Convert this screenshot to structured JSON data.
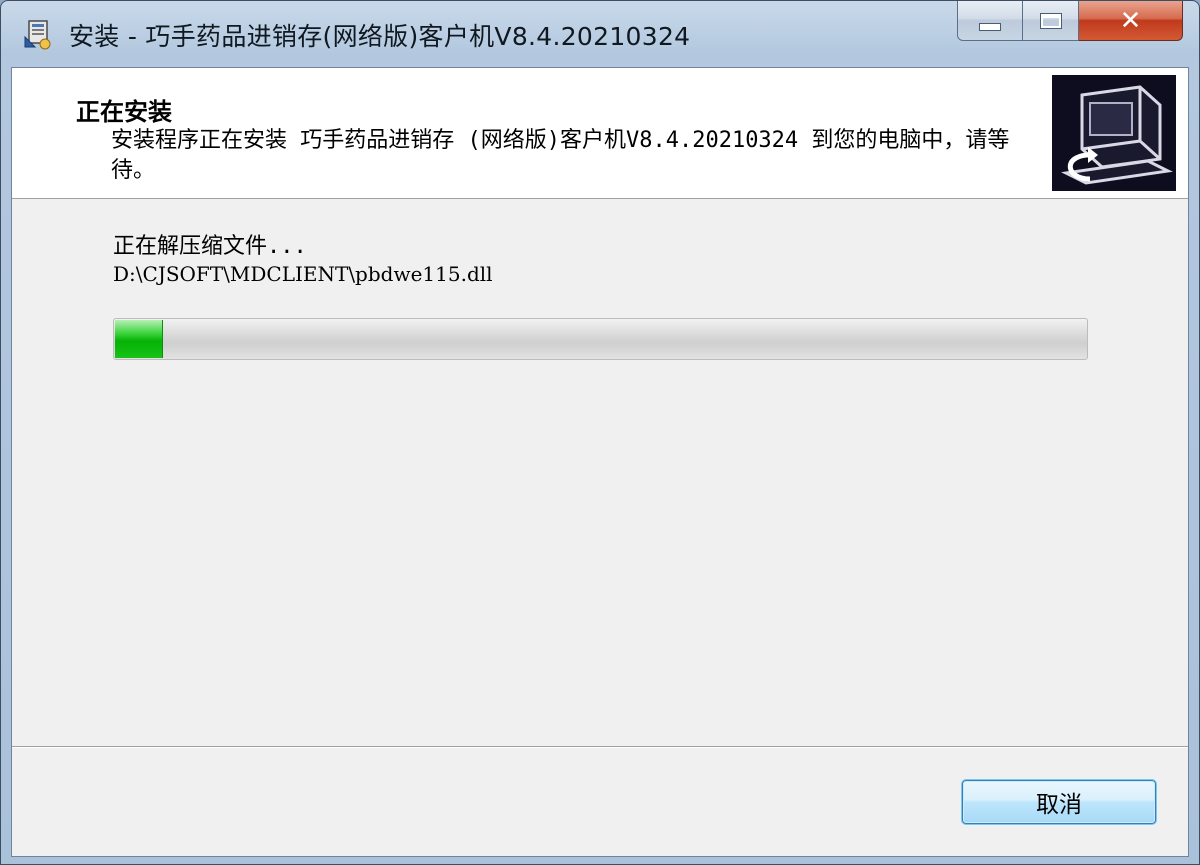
{
  "window": {
    "title": "安装 - 巧手药品进销存(网络版)客户机V8.4.20210324",
    "close_glyph": "✕"
  },
  "header": {
    "title": "正在安装",
    "description": "安装程序正在安装 巧手药品进销存 (网络版)客户机V8.4.20210324 到您的电脑中，请等待。",
    "image_icon": "computer-install-icon"
  },
  "status": {
    "label": "正在解压缩文件...",
    "current_file": "D:\\CJSOFT\\MDCLIENT\\pbdwe115.dll",
    "progress": 0.048
  },
  "buttons": {
    "cancel_label": "取消"
  },
  "colors": {
    "progress_fill": "#07b207",
    "close_button": "#c0391c",
    "header_bg": "#ffffff",
    "client_bg": "#f0f0f0"
  }
}
